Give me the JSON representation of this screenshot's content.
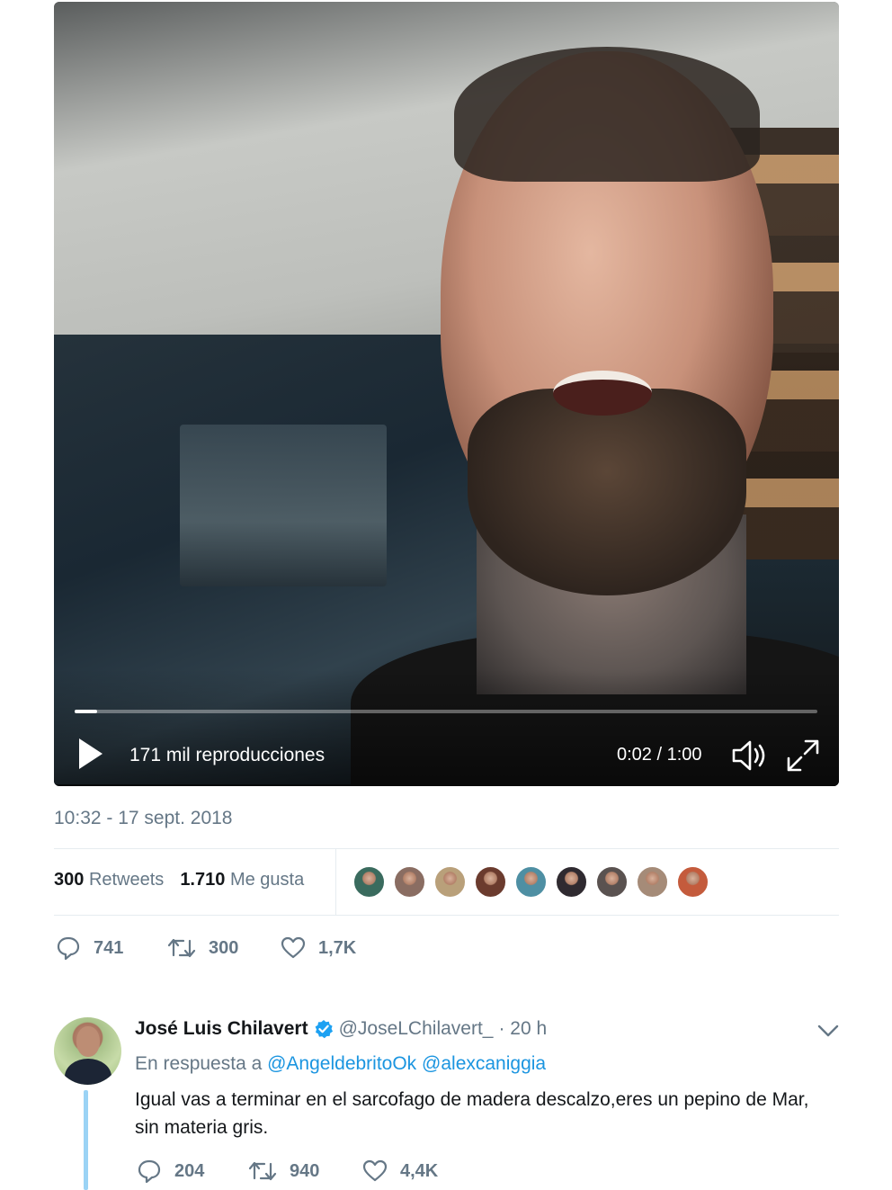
{
  "video": {
    "views": "171 mil reproducciones",
    "time": "0:02 / 1:00",
    "progress_fraction": 0.03
  },
  "tweet": {
    "timestamp": "10:32 - 17 sept. 2018",
    "retweets_count": "300",
    "retweets_label": "Retweets",
    "likes_count": "1.710",
    "likes_label": "Me gusta",
    "liker_avatar_colors": [
      "#3a6b5e",
      "#8a6d62",
      "#b9a07a",
      "#6b3b2e",
      "#4e8fa3",
      "#2f2a30",
      "#5a5250",
      "#a58b78",
      "#c45b3c"
    ],
    "actions": {
      "replies": "741",
      "retweets": "300",
      "likes": "1,7K"
    }
  },
  "reply": {
    "name": "José Luis Chilavert",
    "handle": "@JoseLChilavert_",
    "time": "· 20 h",
    "in_reply_prefix": "En respuesta a",
    "mention_1": "@AngeldebritoOk",
    "mention_2": "@alexcaniggia",
    "text": "Igual vas a terminar en el sarcofago de madera descalzo,eres un pepino de Mar, sin materia gris.",
    "actions": {
      "replies": "204",
      "retweets": "940",
      "likes": "4,4K"
    }
  },
  "colors": {
    "link": "#1b95e0",
    "muted": "#657786",
    "verified": "#1da1f2",
    "thread": "#9bd3f5"
  }
}
